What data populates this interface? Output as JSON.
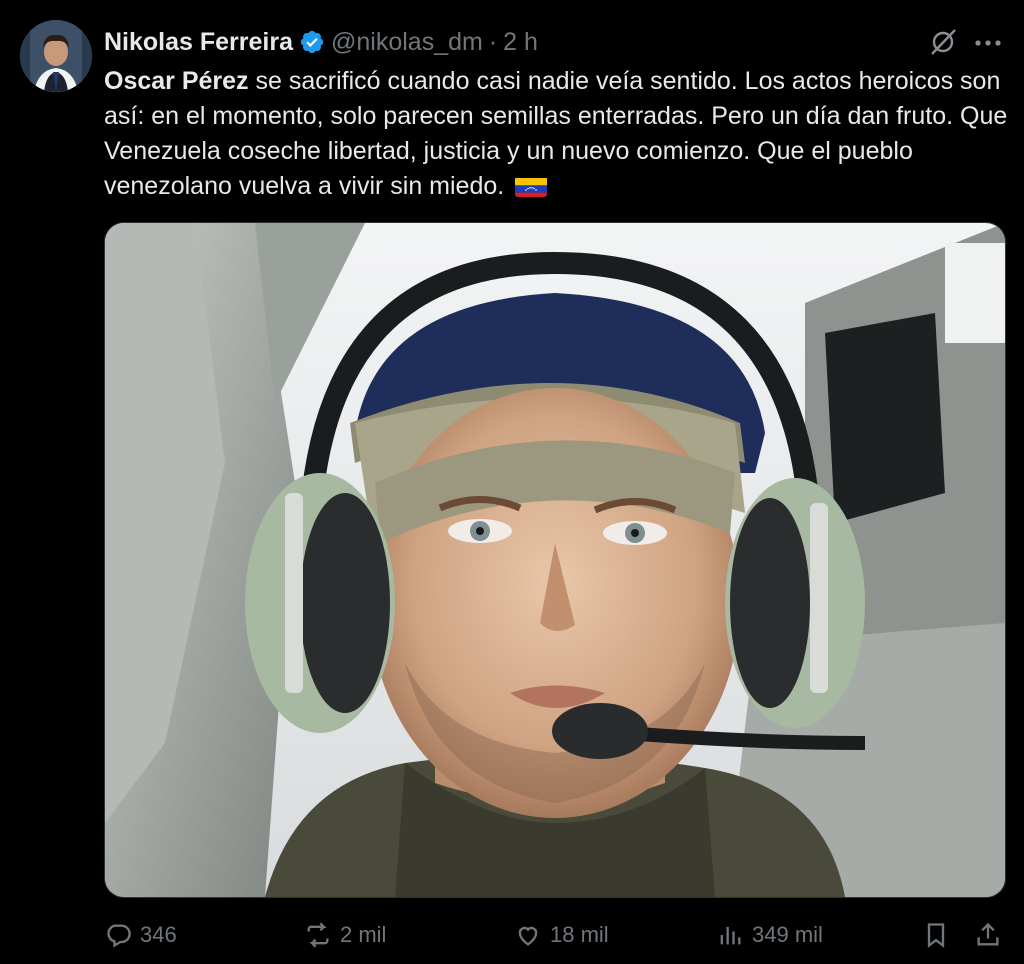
{
  "tweet": {
    "author_name": "Nikolas Ferreira",
    "author_handle": "@nikolas_dm",
    "separator": "·",
    "time": "2 h",
    "text_mention": "Oscar Pérez",
    "text_body": " se sacrificó cuando casi nadie veía sentido. Los actos heroicos son así: en el momento, solo parecen semillas enterradas. Pero un día dan fruto. Que Venezuela coseche libertad, justicia y un nuevo comienzo. Que el pueblo venezolano vuelva a vivir sin miedo. "
  },
  "actions": {
    "replies": "346",
    "reposts": "2 mil",
    "likes": "18 mil",
    "views": "349 mil"
  },
  "icons": {
    "verified": "verified-badge-icon",
    "grok": "grok-icon",
    "more": "more-options-icon",
    "reply": "reply-icon",
    "repost": "repost-icon",
    "like": "like-icon",
    "views": "views-icon",
    "bookmark": "bookmark-icon",
    "share": "share-icon"
  },
  "colors": {
    "background": "#000000",
    "text": "#e7e9ea",
    "muted": "#71767b",
    "verified": "#1d9bf0"
  }
}
